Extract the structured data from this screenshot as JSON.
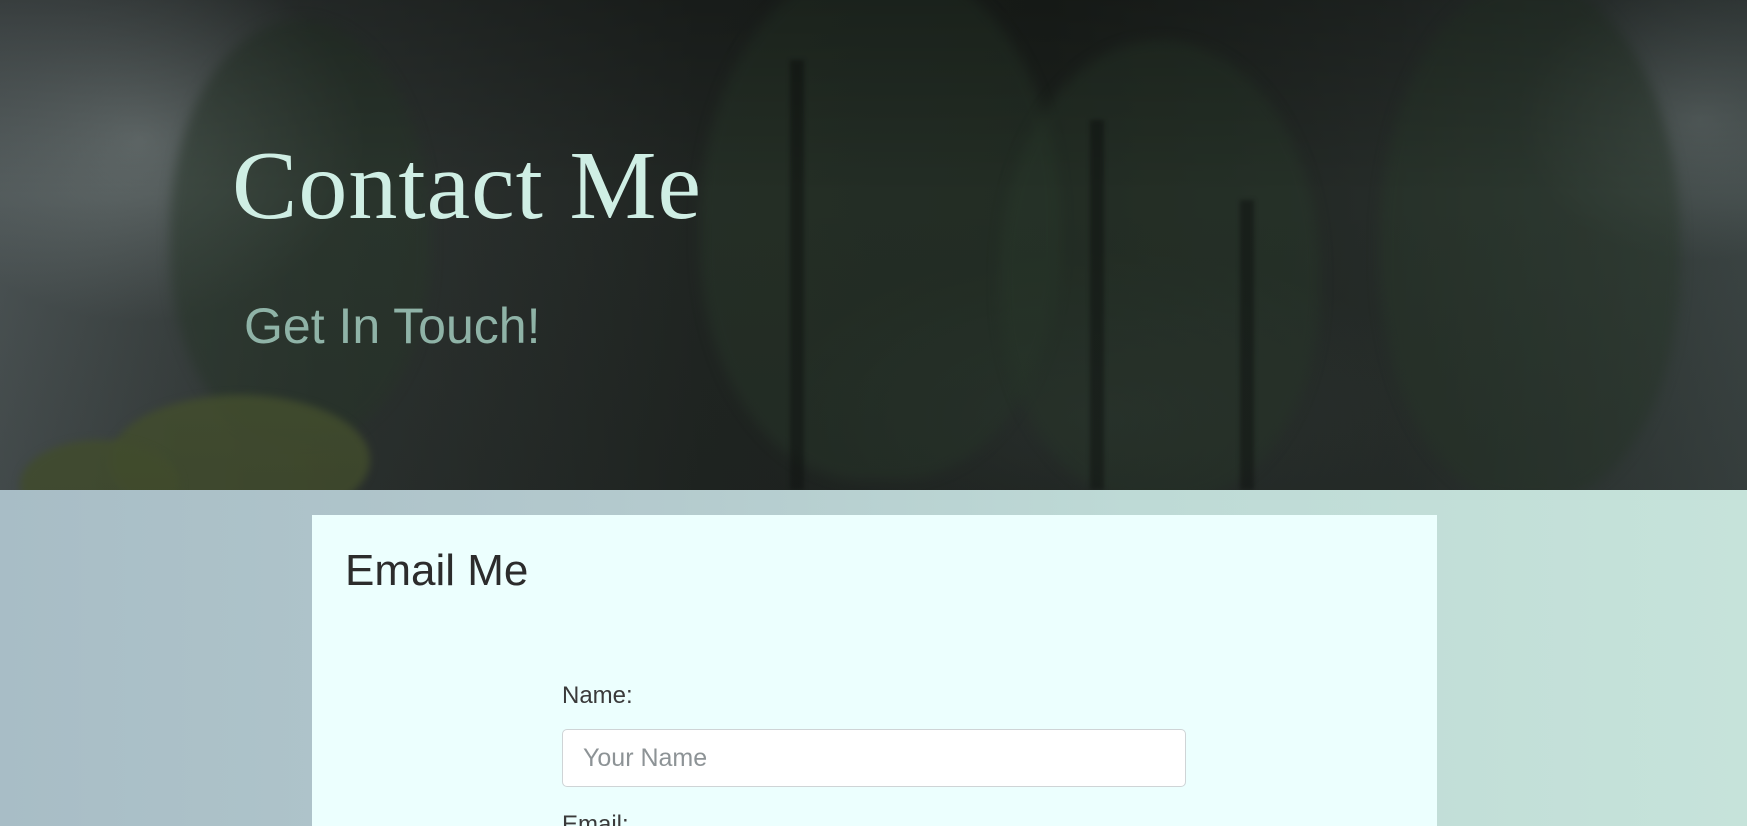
{
  "hero": {
    "title": "Contact Me",
    "subtitle": "Get In Touch!"
  },
  "email_card": {
    "title": "Email Me",
    "name_label": "Name:",
    "name_placeholder": "Your Name",
    "email_label": "Email:"
  },
  "colors": {
    "title_text": "#cfeee4",
    "subtitle_text": "#8fb3a7",
    "card_background": "#ecfffe",
    "band_left": "#a8bdc6",
    "band_right": "#c6e3da"
  }
}
